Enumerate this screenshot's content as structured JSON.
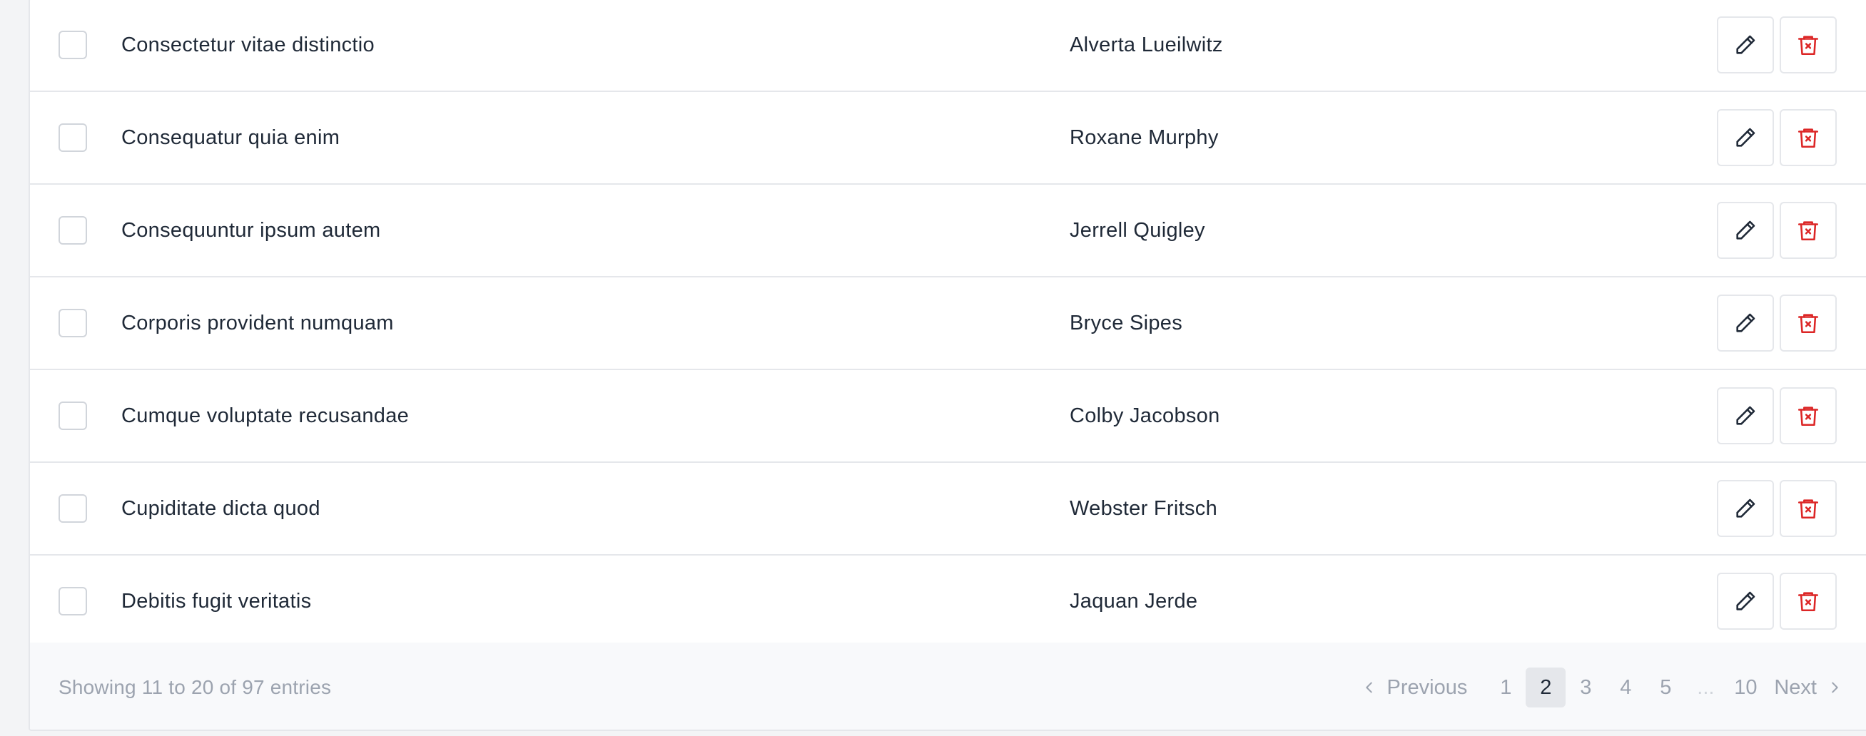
{
  "table": {
    "rows": [
      {
        "title": "Consectetur vitae distinctio",
        "author": "Alverta Lueilwitz"
      },
      {
        "title": "Consequatur quia enim",
        "author": "Roxane Murphy"
      },
      {
        "title": "Consequuntur ipsum autem",
        "author": "Jerrell Quigley"
      },
      {
        "title": "Corporis provident numquam",
        "author": "Bryce Sipes"
      },
      {
        "title": "Cumque voluptate recusandae",
        "author": "Colby Jacobson"
      },
      {
        "title": "Cupiditate dicta quod",
        "author": "Webster Fritsch"
      },
      {
        "title": "Debitis fugit veritatis",
        "author": "Jaquan Jerde"
      }
    ],
    "icons": {
      "edit": "pencil-icon",
      "delete": "trash-icon"
    }
  },
  "footer": {
    "info": "Showing 11 to 20 of 97 entries"
  },
  "pagination": {
    "previous_label": "Previous",
    "next_label": "Next",
    "pages": [
      "1",
      "2",
      "3",
      "4",
      "5",
      "...",
      "10"
    ],
    "current_page": "2"
  },
  "colors": {
    "delete_icon": "#dc2626",
    "edit_icon": "#1f2937",
    "active_page_bg": "#e5e7eb",
    "muted_text": "#9ca3af"
  }
}
